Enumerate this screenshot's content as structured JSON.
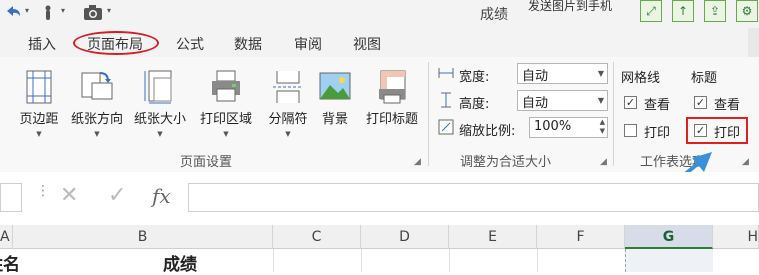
{
  "window": {
    "title": "成绩"
  },
  "toolbar_right": {
    "send_to_phone": "发送图片到手机"
  },
  "tabs": [
    "插入",
    "页面布局",
    "公式",
    "数据",
    "审阅",
    "视图"
  ],
  "active_tab": "页面布局",
  "ribbon": {
    "page_setup": {
      "group_label": "页面设置",
      "buttons": [
        "页边距",
        "纸张方向",
        "纸张大小",
        "打印区域",
        "分隔符",
        "背景",
        "打印标题"
      ]
    },
    "scale_to_fit": {
      "group_label": "调整为合适大小",
      "width_label": "宽度:",
      "width_value": "自动",
      "height_label": "高度:",
      "height_value": "自动",
      "scale_label": "缩放比例:",
      "scale_value": "100%"
    },
    "sheet_options": {
      "group_label": "工作表选项",
      "gridlines": {
        "header": "网格线",
        "view_label": "查看",
        "view_checked": true,
        "print_label": "打印",
        "print_checked": false
      },
      "headings": {
        "header": "标题",
        "view_label": "查看",
        "view_checked": true,
        "print_label": "打印",
        "print_checked": true
      }
    }
  },
  "formula_bar": {
    "cancel": "✕",
    "enter": "✓",
    "fx": "fx",
    "value": ""
  },
  "columns": [
    "A",
    "B",
    "C",
    "D",
    "E",
    "F",
    "G",
    "H"
  ],
  "selected_column": "G",
  "row1": {
    "a": "姓名",
    "b": "成绩"
  },
  "colors": {
    "highlight": "#e02020",
    "arrow": "#3a8fd9",
    "selected_col": "#2e7d32"
  }
}
